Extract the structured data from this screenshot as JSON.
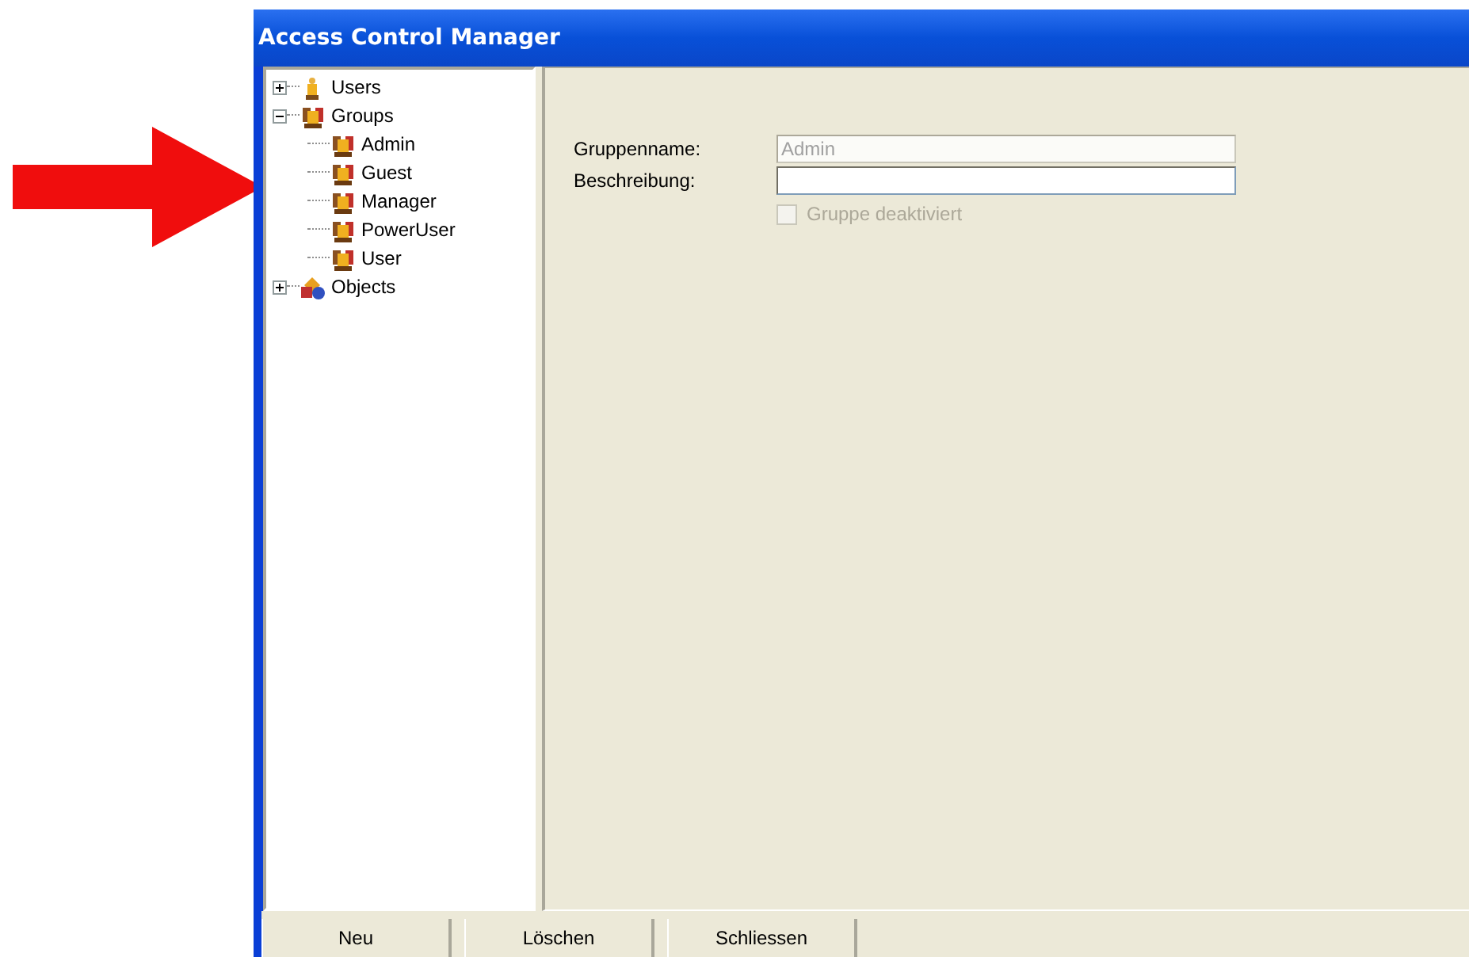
{
  "window": {
    "title": "Access Control Manager"
  },
  "tree": [
    {
      "label": "Users",
      "kind": "user",
      "expanded": false
    },
    {
      "label": "Groups",
      "kind": "group",
      "expanded": true,
      "children": [
        {
          "label": "Admin",
          "kind": "group"
        },
        {
          "label": "Guest",
          "kind": "group"
        },
        {
          "label": "Manager",
          "kind": "group"
        },
        {
          "label": "PowerUser",
          "kind": "group"
        },
        {
          "label": "User",
          "kind": "group"
        }
      ]
    },
    {
      "label": "Objects",
      "kind": "objects",
      "expanded": false
    }
  ],
  "form": {
    "fields": [
      {
        "label": "Gruppenname:",
        "value": "Admin",
        "disabled": true
      },
      {
        "label": "Beschreibung:",
        "disabled": false
      }
    ],
    "checkbox": {
      "label": "Gruppe deaktiviert",
      "checked": false,
      "disabled": true
    }
  },
  "buttons": [
    "Neu",
    "Löschen",
    "Schliessen"
  ]
}
